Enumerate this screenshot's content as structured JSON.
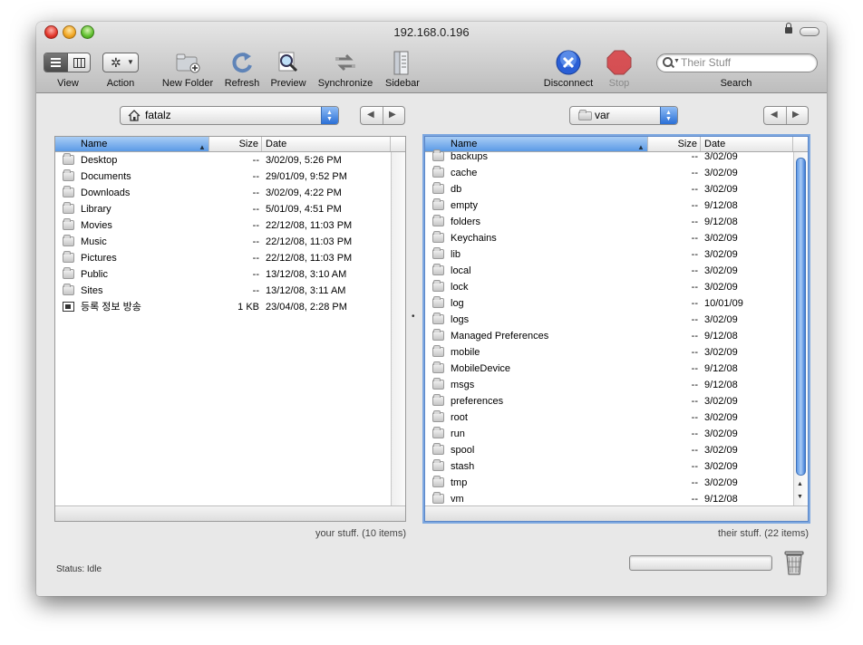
{
  "window": {
    "title": "192.168.0.196"
  },
  "toolbar": {
    "view_label": "View",
    "action_label": "Action",
    "new_folder_label": "New Folder",
    "refresh_label": "Refresh",
    "preview_label": "Preview",
    "synchronize_label": "Synchronize",
    "sidebar_label": "Sidebar",
    "disconnect_label": "Disconnect",
    "stop_label": "Stop",
    "search_label": "Search",
    "search_placeholder": "Their Stuff"
  },
  "left_pane": {
    "path": "fatalz",
    "columns": {
      "name": "Name",
      "size": "Size",
      "date": "Date"
    },
    "status": "your stuff. (10 items)",
    "items": [
      {
        "name": "Desktop",
        "size": "--",
        "date": "3/02/09, 5:26 PM",
        "icon": "desktop-folder-icon"
      },
      {
        "name": "Documents",
        "size": "--",
        "date": "29/01/09, 9:52 PM",
        "icon": "documents-folder-icon"
      },
      {
        "name": "Downloads",
        "size": "--",
        "date": "3/02/09, 4:22 PM",
        "icon": "downloads-folder-icon"
      },
      {
        "name": "Library",
        "size": "--",
        "date": "5/01/09, 4:51 PM",
        "icon": "library-folder-icon"
      },
      {
        "name": "Movies",
        "size": "--",
        "date": "22/12/08, 11:03 PM",
        "icon": "movies-folder-icon"
      },
      {
        "name": "Music",
        "size": "--",
        "date": "22/12/08, 11:03 PM",
        "icon": "music-folder-icon"
      },
      {
        "name": "Pictures",
        "size": "--",
        "date": "22/12/08, 11:03 PM",
        "icon": "pictures-folder-icon"
      },
      {
        "name": "Public",
        "size": "--",
        "date": "13/12/08, 3:10 AM",
        "icon": "public-folder-icon"
      },
      {
        "name": "Sites",
        "size": "--",
        "date": "13/12/08, 3:11 AM",
        "icon": "sites-folder-icon"
      },
      {
        "name": "등록 정보 방송",
        "size": "1 KB",
        "date": "23/04/08, 2:28 PM",
        "icon": "document-icon"
      }
    ]
  },
  "right_pane": {
    "path": "var",
    "columns": {
      "name": "Name",
      "size": "Size",
      "date": "Date"
    },
    "status": "their stuff. (22 items)",
    "items": [
      {
        "name": "backups",
        "size": "--",
        "date": "3/02/09"
      },
      {
        "name": "cache",
        "size": "--",
        "date": "3/02/09"
      },
      {
        "name": "db",
        "size": "--",
        "date": "3/02/09"
      },
      {
        "name": "empty",
        "size": "--",
        "date": "9/12/08"
      },
      {
        "name": "folders",
        "size": "--",
        "date": "9/12/08"
      },
      {
        "name": "Keychains",
        "size": "--",
        "date": "3/02/09"
      },
      {
        "name": "lib",
        "size": "--",
        "date": "3/02/09"
      },
      {
        "name": "local",
        "size": "--",
        "date": "3/02/09"
      },
      {
        "name": "lock",
        "size": "--",
        "date": "3/02/09"
      },
      {
        "name": "log",
        "size": "--",
        "date": "10/01/09"
      },
      {
        "name": "logs",
        "size": "--",
        "date": "3/02/09"
      },
      {
        "name": "Managed Preferences",
        "size": "--",
        "date": "9/12/08"
      },
      {
        "name": "mobile",
        "size": "--",
        "date": "3/02/09"
      },
      {
        "name": "MobileDevice",
        "size": "--",
        "date": "9/12/08"
      },
      {
        "name": "msgs",
        "size": "--",
        "date": "9/12/08"
      },
      {
        "name": "preferences",
        "size": "--",
        "date": "3/02/09"
      },
      {
        "name": "root",
        "size": "--",
        "date": "3/02/09"
      },
      {
        "name": "run",
        "size": "--",
        "date": "3/02/09"
      },
      {
        "name": "spool",
        "size": "--",
        "date": "3/02/09"
      },
      {
        "name": "stash",
        "size": "--",
        "date": "3/02/09"
      },
      {
        "name": "tmp",
        "size": "--",
        "date": "3/02/09"
      },
      {
        "name": "vm",
        "size": "--",
        "date": "9/12/08"
      }
    ]
  },
  "statusbar": {
    "text": "Status: Idle"
  },
  "colors": {
    "accent": "#5b9ae6",
    "stop": "#d9262b",
    "disconnect": "#2a5fd6"
  }
}
